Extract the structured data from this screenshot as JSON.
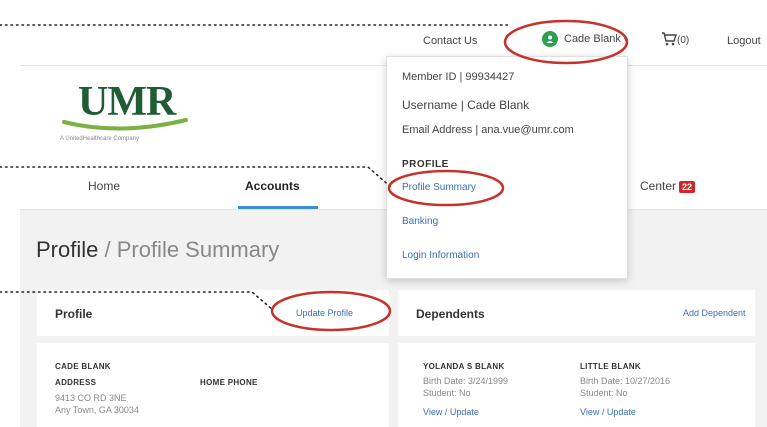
{
  "topbar": {
    "contact": "Contact Us",
    "user_name": "Cade Blank",
    "cart_count": "(0)",
    "logout": "Logout"
  },
  "logo": {
    "word": "UMR",
    "tagline": "A UnitedHealthcare Company"
  },
  "nav": {
    "home": "Home",
    "accounts": "Accounts",
    "center": "Center",
    "center_badge": "22"
  },
  "page": {
    "title_main": "Profile",
    "title_sep": " / ",
    "title_sub": "Profile Summary"
  },
  "profile_card": {
    "title": "Profile",
    "action": "Update Profile",
    "name": "CADE BLANK",
    "address_label": "ADDRESS",
    "address_line1": "9413 CO RD 3NE",
    "address_line2": "Any Town, GA 30034",
    "phone_label": "HOME PHONE"
  },
  "dependents_card": {
    "title": "Dependents",
    "action": "Add Dependent",
    "dependents": [
      {
        "name": "YOLANDA S BLANK",
        "birth": "Birth Date: 3/24/1999",
        "student": "Student: No",
        "link": "View / Update"
      },
      {
        "name": "LITTLE BLANK",
        "birth": "Birth Date: 10/27/2016",
        "student": "Student: No",
        "link": "View / Update"
      }
    ]
  },
  "dropdown": {
    "member_id": "Member ID  |  99934427",
    "username": "Username  |  Cade Blank",
    "email": "Email Address  |  ana.vue@umr.com",
    "section": "PROFILE",
    "links": [
      "Profile Summary",
      "Banking",
      "Login Information"
    ]
  },
  "colors": {
    "accent_link": "#3b6fb6",
    "annotation_red": "#c8322b",
    "brand_green": "#1f5c34",
    "nav_active": "#3b8fd8"
  },
  "icons": [
    "user-avatar-icon",
    "chevron-down-icon",
    "cart-icon"
  ]
}
